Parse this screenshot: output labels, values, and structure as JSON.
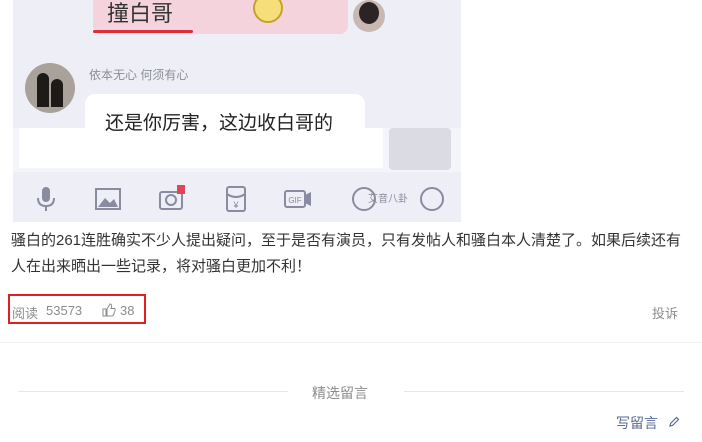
{
  "screenshot": {
    "self_bubble_text": "撞白哥",
    "other_name": "依本无心 何须有心",
    "other_bubble_text": "还是你厉害，这边收白哥的",
    "watermark": "艾音八卦",
    "toolbar_icons": [
      "microphone-icon",
      "image-icon",
      "camera-icon",
      "redpacket-icon",
      "gif-icon",
      "emoji-icon",
      "plus-icon"
    ]
  },
  "article": {
    "paragraph": "骚白的261连胜确实不少人提出疑问，至于是否有演员，只有发帖人和骚白本人清楚了。如果后续还有人在出来晒出一些记录，将对骚白更加不利！"
  },
  "stats": {
    "read_label": "阅读",
    "read_count": "53573",
    "like_count": "38",
    "report_label": "投诉"
  },
  "comments": {
    "section_title": "精选留言",
    "write_label": "写留言"
  },
  "colors": {
    "link": "#576b95",
    "highlight_box": "#e02020",
    "self_bubble": "#f5d3dc"
  }
}
